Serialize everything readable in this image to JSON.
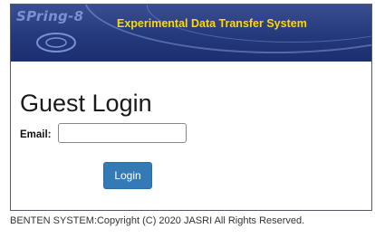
{
  "header": {
    "logo_text": "SPring-8",
    "title": "Experimental Data Transfer System"
  },
  "login": {
    "heading": "Guest Login",
    "email_label": "Email:",
    "email_value": "",
    "button_label": "Login"
  },
  "footer": {
    "copyright": "BENTEN SYSTEM:Copyright (C) 2020 JASRI All Rights Reserved."
  },
  "colors": {
    "header_bg": "#24387c",
    "title_text": "#ffd900",
    "button_bg": "#337ab7"
  }
}
